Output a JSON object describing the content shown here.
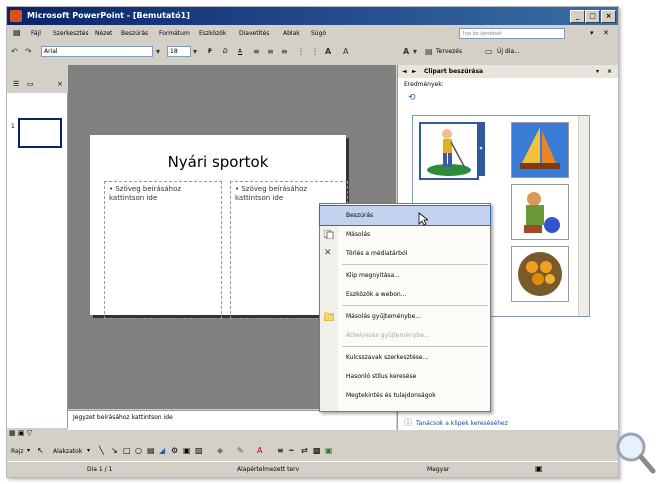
{
  "window": {
    "title": "Microsoft PowerPoint - [Bemutató1]",
    "buttons": {
      "minimize": "_",
      "maximize": "□",
      "close": "×"
    }
  },
  "menubar": {
    "items": [
      "Fájl",
      "Szerkesztés",
      "Nézet",
      "Beszúrás",
      "Formátum",
      "Eszközök",
      "Diavetítés",
      "Ablak",
      "Súgó"
    ],
    "help_placeholder": "Írja be kérdését"
  },
  "toolbar": {
    "font": "Arial",
    "font_size": "18",
    "bold": "F",
    "italic": "D",
    "underline": "A",
    "tervezes": "Tervezés",
    "uj_dia": "Új dia..."
  },
  "slide_pane": {
    "slide_number": "1"
  },
  "slide": {
    "title": "Nyári sportok",
    "left_placeholder": "• Szöveg beírásához kattintson ide",
    "right_placeholder": "• Szöveg beírásához kattintson ide"
  },
  "notes": {
    "placeholder": "Jegyzet beírásához kattintson ide"
  },
  "task_pane": {
    "title": "Clipart beszúrása",
    "results_label": "Eredmények:",
    "link": "Tanácsok a klipek kereséséhez"
  },
  "context_menu": {
    "items": [
      {
        "label": "Beszúrás",
        "state": "hover"
      },
      {
        "label": "Másolás",
        "state": "normal"
      },
      {
        "label": "Törlés a médiatárból",
        "state": "normal"
      },
      {
        "label": "Klip megnyitása...",
        "state": "normal"
      },
      {
        "label": "Eszközök a webon...",
        "state": "normal"
      },
      {
        "label": "Másolás gyűjteménybe...",
        "state": "normal"
      },
      {
        "label": "Áthelyezés gyűjteménybe...",
        "state": "disabled"
      },
      {
        "label": "Kulcsszavak szerkesztése...",
        "state": "normal"
      },
      {
        "label": "Hasonló stílus keresése",
        "state": "normal"
      },
      {
        "label": "Megtekintés és tulajdonságok",
        "state": "normal"
      }
    ]
  },
  "drawing_toolbar": {
    "rajz": "Rajz",
    "alakzatok": "Alakzatok"
  },
  "statusbar": {
    "slide_info": "Dia 1 / 1",
    "design": "Alapértelmezett terv",
    "language": "Magyar"
  },
  "colors": {
    "titlebar_start": "#0a246a",
    "titlebar_end": "#3a6ea5",
    "menu_hover": "#c1d2ee",
    "canvas": "#808080"
  }
}
